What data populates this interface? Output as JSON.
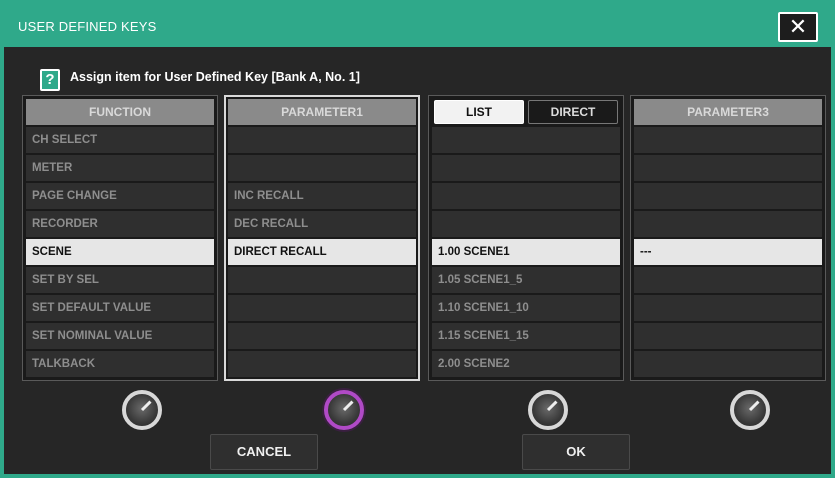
{
  "dialog": {
    "title": "USER DEFINED KEYS",
    "close_label": "✕",
    "help_label": "?",
    "assign_text": "Assign item for User Defined Key [Bank A, No. 1]"
  },
  "columns": {
    "function": {
      "header": "FUNCTION",
      "items": [
        "CH SELECT",
        "METER",
        "PAGE CHANGE",
        "RECORDER",
        "SCENE",
        "SET BY SEL",
        "SET DEFAULT VALUE",
        "SET NOMINAL VALUE",
        "TALKBACK"
      ],
      "selected": "SCENE"
    },
    "parameter1": {
      "header": "PARAMETER1",
      "items": [
        "",
        "",
        "INC RECALL",
        "DEC RECALL",
        "DIRECT RECALL",
        "",
        "",
        "",
        ""
      ],
      "selected": "DIRECT RECALL"
    },
    "parameter2": {
      "tabs": [
        "LIST",
        "DIRECT"
      ],
      "active_tab": "LIST",
      "items": [
        "",
        "",
        "",
        "",
        "1.00 SCENE1",
        "1.05 SCENE1_5",
        "1.10 SCENE1_10",
        "1.15 SCENE1_15",
        "2.00 SCENE2"
      ],
      "selected": "1.00 SCENE1"
    },
    "parameter3": {
      "header": "PARAMETER3",
      "items": [
        "",
        "",
        "",
        "",
        "---",
        "",
        "",
        "",
        ""
      ],
      "selected": "---"
    }
  },
  "buttons": {
    "cancel": "CANCEL",
    "ok": "OK"
  },
  "colors": {
    "accent": "#2fa98a",
    "selected_row": "#e6e6e6",
    "active_knob": "#b04ac6"
  },
  "icons": {
    "close": "close-icon",
    "help": "help-icon",
    "knob": "rotary-encoder-icon"
  }
}
